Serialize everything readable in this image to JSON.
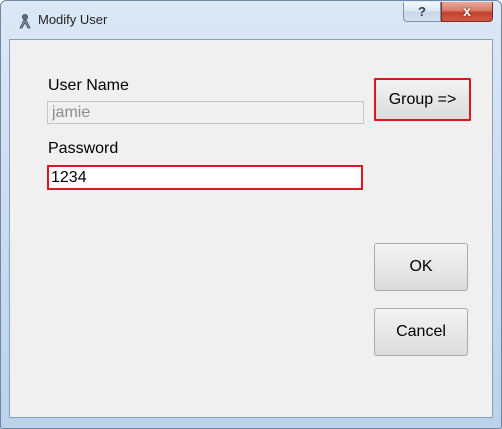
{
  "window": {
    "title": "Modify User",
    "app_icon": "user-icon",
    "help_label": "?",
    "close_label": "x"
  },
  "form": {
    "username_label": "User Name",
    "username_value": "jamie",
    "password_label": "Password",
    "password_value": "1234"
  },
  "buttons": {
    "group_label": "Group =>",
    "ok_label": "OK",
    "cancel_label": "Cancel"
  },
  "colors": {
    "highlight": "#e0141e",
    "client_bg": "#f0f0f0",
    "frame": "#c9dbef"
  }
}
